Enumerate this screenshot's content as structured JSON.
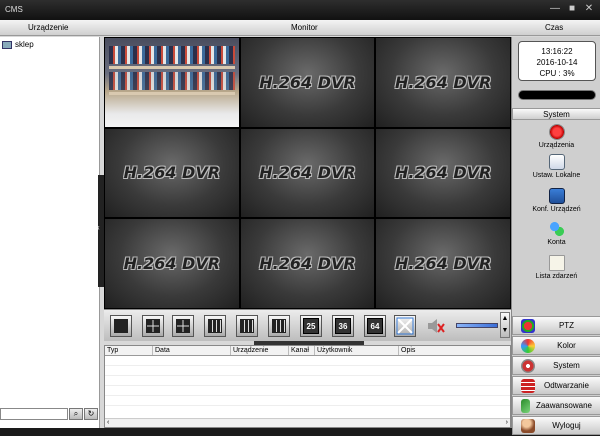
{
  "window": {
    "title": "CMS",
    "minimize": "—",
    "maximize": "■",
    "close": "✕"
  },
  "menubar": {
    "left": "Urządzenie",
    "center": "Monitor",
    "right": "Czas"
  },
  "device_tree": {
    "root_label": "sklep"
  },
  "video_grid": {
    "channels": [
      {
        "label": ""
      },
      {
        "label": "H.264 DVR"
      },
      {
        "label": "H.264 DVR"
      },
      {
        "label": "H.264 DVR"
      },
      {
        "label": "H.264 DVR"
      },
      {
        "label": "H.264 DVR"
      },
      {
        "label": "H.264 DVR"
      },
      {
        "label": "H.264 DVR"
      },
      {
        "label": "H.264 DVR"
      }
    ]
  },
  "toolbar": {
    "split_25": "25",
    "split_36": "36",
    "split_64": "64"
  },
  "log_table": {
    "columns": [
      "Typ",
      "Data",
      "Urządzenie",
      "Kanał",
      "Użytkownik",
      "Opis"
    ]
  },
  "clock": {
    "time": "13:16:22",
    "date": "2016-10-14",
    "cpu": "CPU : 3%"
  },
  "system_panel": {
    "header": "System",
    "items": [
      "Urządzenia",
      "Ustaw. Lokalne",
      "Konf. Urządzeń",
      "Konta",
      "Lista zdarzeń"
    ]
  },
  "bottom_buttons": [
    "PTZ",
    "Kolor",
    "System",
    "Odtwarzanie",
    "Zaawansowane",
    "Wyloguj"
  ],
  "colors": {
    "titlebar": "#111111",
    "accent_blue": "#3a6ed8"
  }
}
